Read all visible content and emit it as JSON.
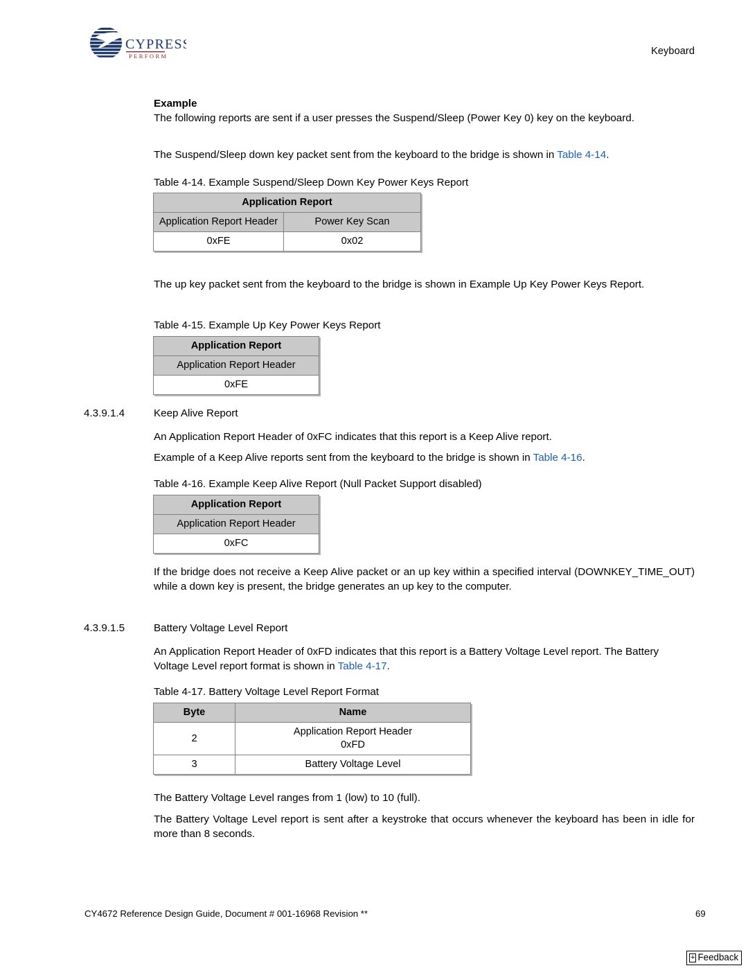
{
  "header": {
    "title": "Keyboard",
    "logo_word": "CYPRESS",
    "logo_tagline": "PERFORM"
  },
  "body": {
    "example_heading": "Example",
    "p_example_intro": "The following reports are sent if a user presses the Suspend/Sleep (Power Key 0) key on the keyboard.",
    "p_down_key_pre": "The Suspend/Sleep down key packet sent from the keyboard to the bridge is shown in ",
    "p_down_key_link": "Table 4-14",
    "p_down_key_post": ".",
    "p_up_key": "The up key packet sent from the keyboard to the bridge is shown in Example Up Key Power Keys Report.",
    "p_keep_alive_header": "An Application Report Header of 0xFC indicates that this report is a Keep Alive report.",
    "p_keep_alive_example_pre": "Example of a Keep Alive reports sent from the keyboard to the bridge is shown in ",
    "p_keep_alive_example_link": "Table 4-16",
    "p_keep_alive_example_post": ".",
    "p_downkey_timeout": "If the bridge does not receive a Keep Alive packet or an up key within a specified interval (DOWNKEY_TIME_OUT) while a down key is present, the bridge generates an up key to the computer.",
    "p_battery_header_pre": "An Application Report Header of 0xFD indicates that this report is a Battery Voltage Level report. The Battery Voltage Level report format is shown in ",
    "p_battery_header_link": "Table 4-17",
    "p_battery_header_post": ".",
    "p_battery_range": "The Battery Voltage Level ranges from 1 (low) to 10 (full).",
    "p_battery_sent": "The Battery Voltage Level report is sent after a keystroke that occurs whenever the keyboard has been in idle for more than 8 seconds."
  },
  "sections": [
    {
      "number": "4.3.9.1.4",
      "title": "Keep Alive Report"
    },
    {
      "number": "4.3.9.1.5",
      "title": "Battery Voltage Level Report"
    }
  ],
  "tables": [
    {
      "caption": "Table 4-14.  Example Suspend/Sleep Down Key Power Keys Report",
      "group_header": "Application Report",
      "col_headers": [
        "Application Report Header",
        "Power Key Scan"
      ],
      "values": [
        "0xFE",
        "0x02"
      ]
    },
    {
      "caption": "Table 4-15.  Example Up Key Power Keys Report",
      "group_header": "Application Report",
      "col_headers": [
        "Application Report Header"
      ],
      "values": [
        "0xFE"
      ]
    },
    {
      "caption": "Table 4-16.  Example Keep Alive Report (Null Packet Support disabled)",
      "group_header": "Application Report",
      "col_headers": [
        "Application Report Header"
      ],
      "values": [
        "0xFC"
      ]
    },
    {
      "caption": "Table 4-17.  Battery Voltage Level Report Format",
      "col_headers": [
        "Byte",
        "Name"
      ],
      "rows": [
        {
          "byte": "2",
          "name_line1": "Application Report Header",
          "name_line2": "0xFD"
        },
        {
          "byte": "3",
          "name_line1": "Battery Voltage Level"
        }
      ]
    }
  ],
  "footer": {
    "left": "CY4672 Reference Design Guide, Document # 001-16968 Revision **",
    "page_number": "69",
    "feedback_plus": "+",
    "feedback_label": "Feedback"
  },
  "colors": {
    "link": "#1a5fb4",
    "table_shade": "#c9c9c9",
    "table_border": "#808080",
    "logo_navy": "#1f3a73",
    "logo_red": "#8c2a2a"
  }
}
